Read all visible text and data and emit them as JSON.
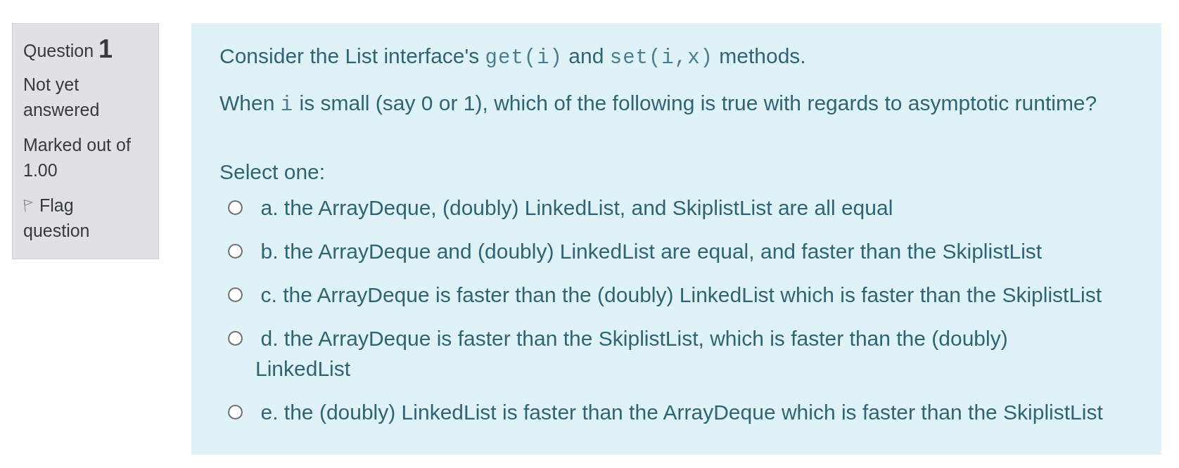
{
  "question_info": {
    "title": "Question **1**",
    "status": "Not yet answered",
    "grade": "Marked out of 1.00",
    "flag": {
      "label": "Flag question",
      "flagged": false
    }
  },
  "question": {
    "text": [
      {
        "kind": "text",
        "text": "Consider the List interface's "
      },
      {
        "kind": "code",
        "text": "get(i)"
      },
      {
        "kind": "text",
        "text": " and "
      },
      {
        "kind": "code",
        "text": "set(i,x)"
      },
      {
        "kind": "text",
        "text": " methods."
      }
    ],
    "prompt": [
      {
        "kind": "text",
        "text": "When "
      },
      {
        "kind": "code",
        "text": "i"
      },
      {
        "kind": "text",
        "text": " is small (say 0 or 1), which of the following is true with regards to asymptotic runtime?"
      }
    ],
    "select_label": "Select one:",
    "options": [
      {
        "label": "a. the ArrayDeque, (doubly) LinkedList, and SkiplistList are all equal",
        "selected": false
      },
      {
        "label": "b. the ArrayDeque and (doubly) LinkedList are equal, and faster than the SkiplistList",
        "selected": false
      },
      {
        "label": "c. the ArrayDeque is faster than the (doubly) LinkedList which is faster than the SkiplistList",
        "selected": false
      },
      {
        "label": "d. the ArrayDeque is faster than the SkiplistList, which is faster than the (doubly) LinkedList",
        "selected": false
      },
      {
        "label": "e. the (doubly) LinkedList is faster than the ArrayDeque which is faster than the SkiplistList",
        "selected": false
      }
    ]
  }
}
